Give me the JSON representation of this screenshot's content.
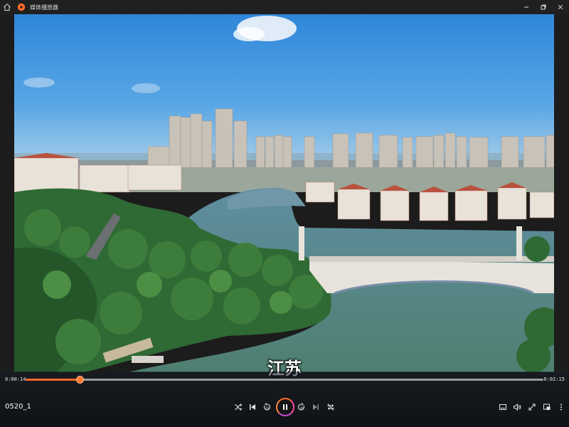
{
  "window": {
    "title": "媒体播放器",
    "icons": {
      "home": "home-icon",
      "logo": "media-player-logo-icon",
      "minimize": "minimize-icon",
      "restore": "restore-icon",
      "close": "close-icon"
    }
  },
  "video": {
    "subtitle": "江苏",
    "scene": "aerial-city-river-bridge-image"
  },
  "player": {
    "current_time": "0:00:14",
    "duration": "0:02:15",
    "progress": 0.104,
    "file_name": "0520_1",
    "accent": "#ff6a2a",
    "controls": {
      "shuffle": "shuffle-icon",
      "previous": "previous-icon",
      "rewind": "rewind-10-icon",
      "play_pause": "pause-icon",
      "forward": "forward-30-icon",
      "next": "next-icon",
      "repeat": "repeat-off-icon",
      "subtitles": "subtitles-icon",
      "volume": "volume-icon",
      "fullscreen": "fullscreen-icon",
      "mini_view": "mini-view-icon",
      "more": "more-icon"
    }
  }
}
